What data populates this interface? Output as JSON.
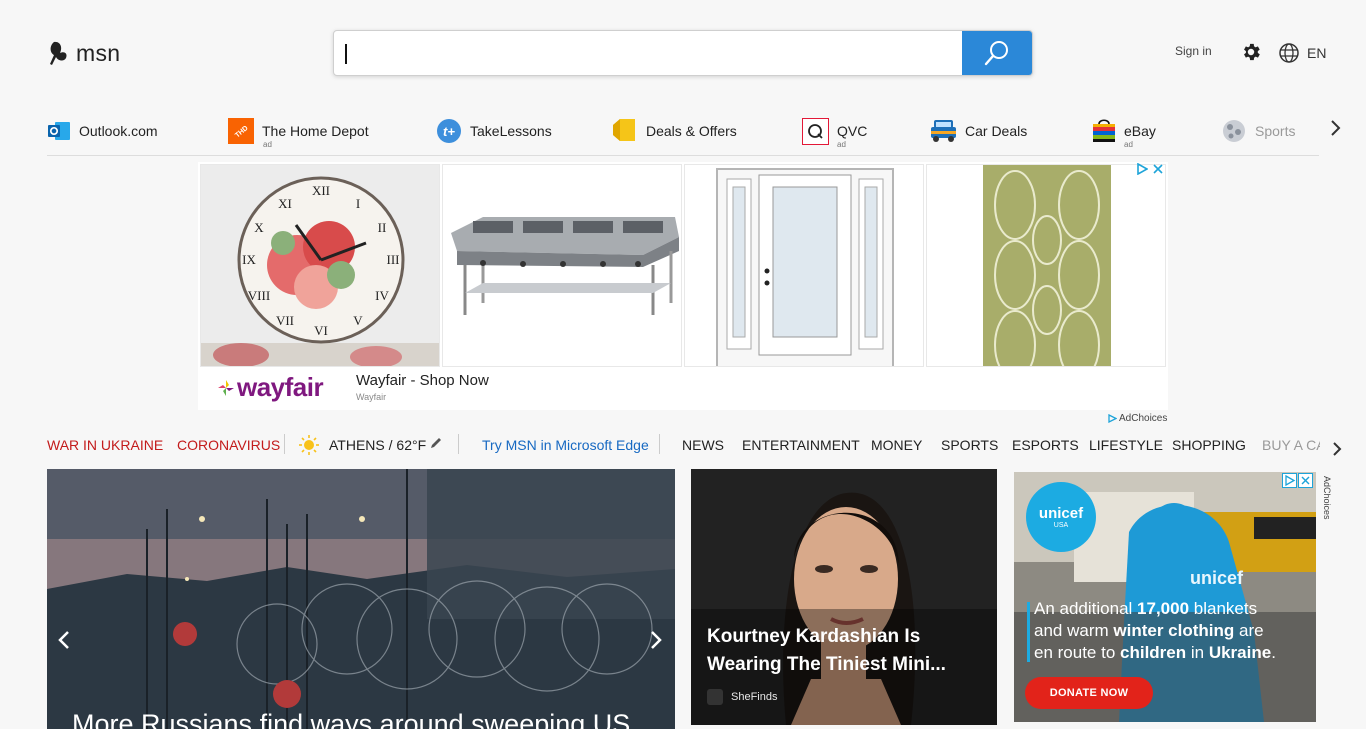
{
  "header": {
    "logo_text": "msn",
    "search": {
      "value": "",
      "placeholder": ""
    },
    "sign_in": "Sign in",
    "language": "EN"
  },
  "quick_links": [
    {
      "label": "Outlook.com",
      "ad": "",
      "icon": "outlook-icon"
    },
    {
      "label": "The Home Depot",
      "ad": "ad",
      "icon": "home-depot-icon"
    },
    {
      "label": "TakeLessons",
      "ad": "",
      "icon": "takelessons-icon"
    },
    {
      "label": "Deals & Offers",
      "ad": "",
      "icon": "deals-tag-icon"
    },
    {
      "label": "QVC",
      "ad": "ad",
      "icon": "qvc-icon"
    },
    {
      "label": "Car Deals",
      "ad": "",
      "icon": "car-icon"
    },
    {
      "label": "eBay",
      "ad": "ad",
      "icon": "ebay-bag-icon"
    },
    {
      "label": "Sports",
      "ad": "",
      "icon": "sports-ball-icon"
    }
  ],
  "ad_banner": {
    "brand": "wayfair",
    "title": "Wayfair - Shop Now",
    "subtitle": "Wayfair",
    "adchoices": "AdChoices"
  },
  "nav": {
    "war": "WAR IN UKRAINE",
    "corona": "CORONAVIRUS",
    "weather": "ATHENS / 62°F",
    "edge": "Try MSN in Microsoft Edge",
    "items": [
      "NEWS",
      "ENTERTAINMENT",
      "MONEY",
      "SPORTS",
      "ESPORTS",
      "LIFESTYLE",
      "SHOPPING",
      "BUY A CA"
    ]
  },
  "hero": {
    "title": "More Russians find ways around sweeping US"
  },
  "card2": {
    "title": "Kourtney Kardashian Is Wearing The Tiniest Mini...",
    "source": "SheFinds"
  },
  "unicef_ad": {
    "logo": "unicef",
    "logo_sub": "USA",
    "shirt_text": "unicef",
    "line1_a": "An additional ",
    "line1_b": "17,000",
    "line1_c": " blankets",
    "line2_a": "and warm ",
    "line2_b": "winter clothing",
    "line2_c": " are",
    "line3_a": "en route to ",
    "line3_b": "children",
    "line3_c": " in ",
    "line3_d": "Ukraine",
    "line3_e": ".",
    "button": "DONATE NOW",
    "adchoices": "AdChoices"
  },
  "colors": {
    "accent_blue": "#2b88d8",
    "nav_red": "#c31b1b",
    "edge_blue": "#1769c2",
    "wayfair_purple": "#7f187f",
    "unicef_blue": "#1cabe2",
    "donate_red": "#e2231a"
  }
}
